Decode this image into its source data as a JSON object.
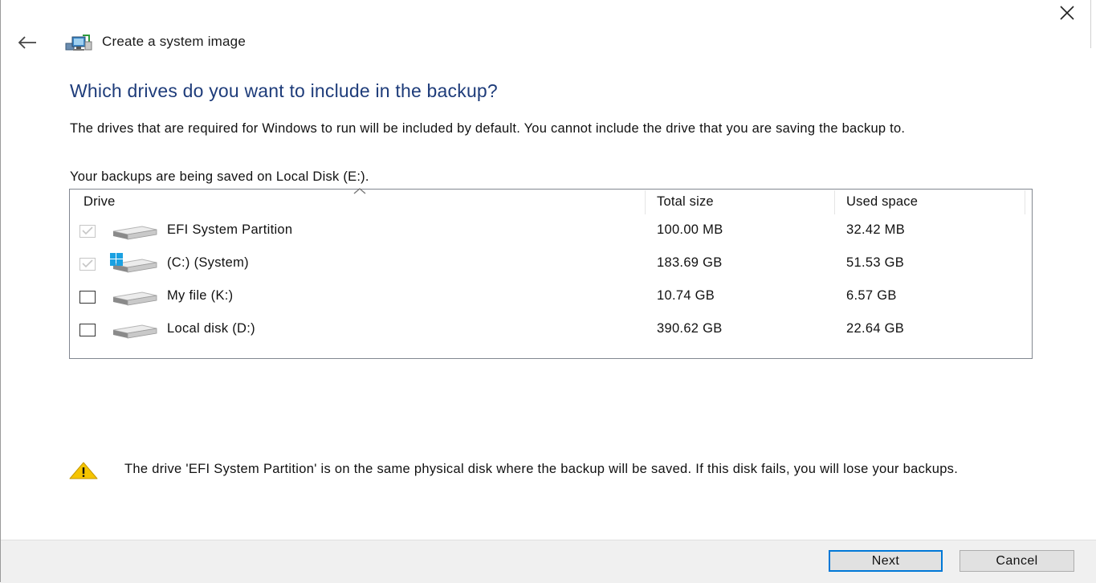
{
  "window": {
    "title": "Create a system image",
    "close_glyph": "✕"
  },
  "page": {
    "heading": "Which drives do you want to include in the backup?",
    "description": "The drives that are required for Windows to run will be included by default. You cannot include the drive that you are saving the backup to.",
    "saved_location": "Your backups are being saved on Local Disk (E:)."
  },
  "table": {
    "columns": [
      "Drive",
      "Total size",
      "Used space"
    ],
    "sorted_column": "Drive",
    "rows": [
      {
        "name": "EFI System Partition",
        "total": "100.00 MB",
        "used": "32.42 MB",
        "checked": true,
        "disabled": true,
        "icon": "drive-icon"
      },
      {
        "name": "(C:) (System)",
        "total": "183.69 GB",
        "used": "51.53 GB",
        "checked": true,
        "disabled": true,
        "icon": "windows-drive-icon"
      },
      {
        "name": "My file (K:)",
        "total": "10.74 GB",
        "used": "6.57 GB",
        "checked": false,
        "disabled": false,
        "icon": "drive-icon"
      },
      {
        "name": "Local disk (D:)",
        "total": "390.62 GB",
        "used": "22.64 GB",
        "checked": false,
        "disabled": false,
        "icon": "drive-icon"
      }
    ]
  },
  "warning": {
    "icon": "warning-icon",
    "text": "The drive 'EFI System Partition' is on the same physical disk where the backup will be saved. If this disk fails, you will lose your backups."
  },
  "buttons": {
    "next": "Next",
    "cancel": "Cancel"
  },
  "colors": {
    "heading": "#1e3c7a",
    "accent": "#0078d7",
    "footer_bg": "#f0f0f0",
    "warning": "#f5c400"
  }
}
